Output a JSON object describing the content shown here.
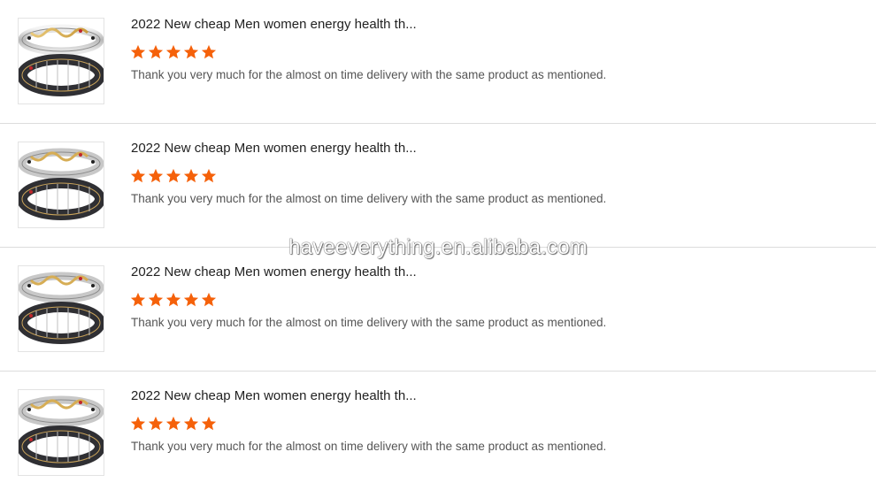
{
  "reviews": [
    {
      "product_title": "2022 New cheap Men women energy health th...",
      "rating": 5,
      "rating_max": 5,
      "comment": "Thank you very much for the almost on time delivery with the same product as mentioned."
    },
    {
      "product_title": "2022 New cheap Men women energy health th...",
      "rating": 5,
      "rating_max": 5,
      "comment": "Thank you very much for the almost on time delivery with the same product as mentioned."
    },
    {
      "product_title": "2022 New cheap Men women energy health th...",
      "rating": 5,
      "rating_max": 5,
      "comment": "Thank you very much for the almost on time delivery with the same product as mentioned."
    },
    {
      "product_title": "2022 New cheap Men women energy health th...",
      "rating": 5,
      "rating_max": 5,
      "comment": "Thank you very much for the almost on time delivery with the same product as mentioned."
    }
  ],
  "watermark": "haveeverything.en.alibaba.com",
  "colors": {
    "star": "#f5610a",
    "title": "#222222",
    "comment": "#555555",
    "divider": "#dcdcdc"
  },
  "icons": {
    "star": "star-icon",
    "thumbnail": "bracelet-product-image"
  }
}
